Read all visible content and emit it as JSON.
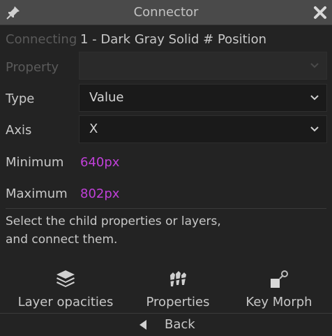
{
  "window": {
    "title": "Connector",
    "icons": {
      "pin": "pin-icon",
      "close": "close-icon"
    }
  },
  "connecting": {
    "label": "Connecting",
    "value": "1 - Dark Gray Solid # Position"
  },
  "property": {
    "label": "Property",
    "value": ""
  },
  "type": {
    "label": "Type",
    "value": "Value"
  },
  "axis": {
    "label": "Axis",
    "value": "X"
  },
  "minimum": {
    "label": "Minimum",
    "value": "640px"
  },
  "maximum": {
    "label": "Maximum",
    "value": "802px"
  },
  "help": {
    "line1": "Select the child properties or layers,",
    "line2": "and connect them."
  },
  "tools": [
    {
      "label": "Layer opacities",
      "icon": "layers-icon"
    },
    {
      "label": "Properties",
      "icon": "properties-icon"
    },
    {
      "label": "Key Morph",
      "icon": "key-morph-icon"
    }
  ],
  "back": {
    "label": "Back",
    "icon": "back-arrow-icon"
  },
  "colors": {
    "background": "#232323",
    "titlebar": "#4a4a4a",
    "accent_value": "#c040d8",
    "dropdown": "#1a1a1a"
  }
}
